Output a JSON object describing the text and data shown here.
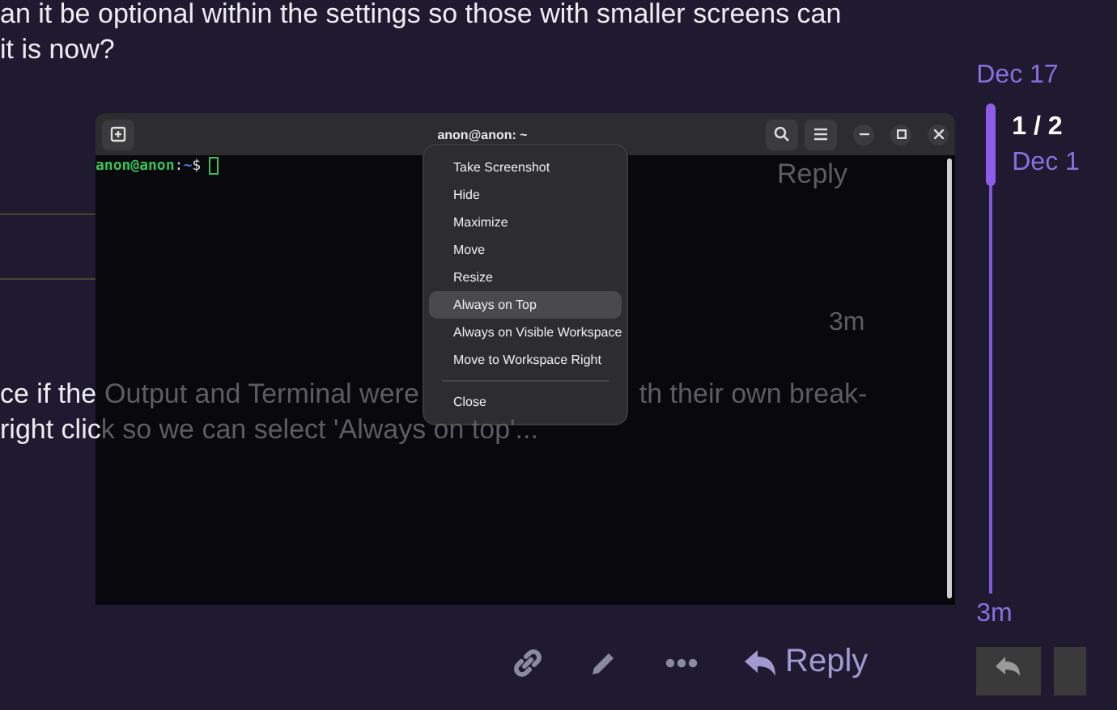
{
  "post_text_top": [
    "an it be optional within the settings so those with smaller screens can",
    "it is now?"
  ],
  "faint_meta": {
    "reply": "Reply",
    "time": "3m"
  },
  "post_lines": [
    [
      {
        "text": "ce if the",
        "covered": false
      },
      {
        "text": "Output and Terminal were",
        "covered": true
      },
      {
        "text": "th their own break-",
        "covered": true
      }
    ],
    [
      {
        "text": "right clic",
        "covered": false
      },
      {
        "text": "k so we can select 'Always on top'...",
        "covered": true
      }
    ]
  ],
  "terminal": {
    "title": "anon@anon: ~",
    "prompt": {
      "user_host": "anon@anon",
      "separator": ":",
      "path": "~",
      "symbol": "$"
    }
  },
  "context_menu": [
    {
      "label": "Take Screenshot",
      "selected": false
    },
    {
      "label": "Hide",
      "selected": false
    },
    {
      "label": "Maximize",
      "selected": false
    },
    {
      "label": "Move",
      "selected": false
    },
    {
      "label": "Resize",
      "selected": false
    },
    {
      "label": "Always on Top",
      "selected": true
    },
    {
      "label": "Always on Visible Workspace",
      "selected": false
    },
    {
      "label": "Move to Workspace Right",
      "selected": false
    },
    {
      "kind": "separator"
    },
    {
      "label": "Close",
      "selected": false
    }
  ],
  "post_actions": {
    "reply": "Reply"
  },
  "timeline": {
    "top_date": "Dec 17",
    "position": "1 / 2",
    "current_date": "Dec 1",
    "bottom_date": "3m"
  }
}
